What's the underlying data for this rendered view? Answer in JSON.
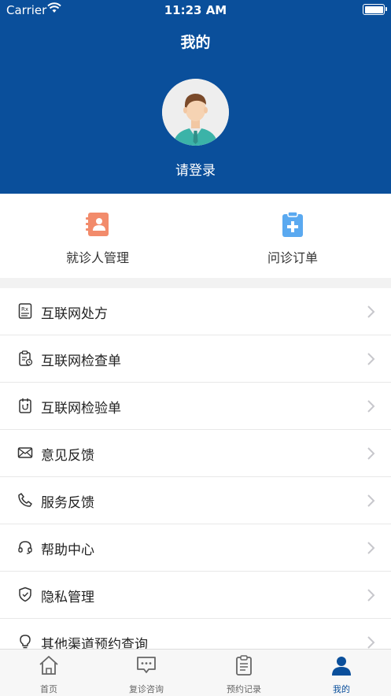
{
  "status_bar": {
    "carrier": "Carrier",
    "time": "11:23 AM"
  },
  "header": {
    "title": "我的",
    "login": "请登录"
  },
  "quick_actions": [
    {
      "label": "就诊人管理",
      "icon": "contact-book-icon",
      "color": "#f28b6b"
    },
    {
      "label": "问诊订单",
      "icon": "clipboard-plus-icon",
      "color": "#5aa9f0"
    }
  ],
  "menu": [
    {
      "label": "互联网处方",
      "icon": "prescription-icon"
    },
    {
      "label": "互联网检查单",
      "icon": "exam-clipboard-icon"
    },
    {
      "label": "互联网检验单",
      "icon": "lab-test-icon"
    },
    {
      "label": "意见反馈",
      "icon": "mail-icon"
    },
    {
      "label": "服务反馈",
      "icon": "phone-icon"
    },
    {
      "label": "帮助中心",
      "icon": "headset-icon"
    },
    {
      "label": "隐私管理",
      "icon": "shield-icon"
    },
    {
      "label": "其他渠道预约查询",
      "icon": "lightbulb-icon"
    }
  ],
  "tabs": [
    {
      "label": "首页",
      "icon": "home-icon"
    },
    {
      "label": "复诊咨询",
      "icon": "chat-icon"
    },
    {
      "label": "预约记录",
      "icon": "clipboard-list-icon"
    },
    {
      "label": "我的",
      "icon": "person-icon",
      "active": true
    }
  ],
  "colors": {
    "brand": "#0a4f9b",
    "active_tab": "#0a4f9b"
  }
}
